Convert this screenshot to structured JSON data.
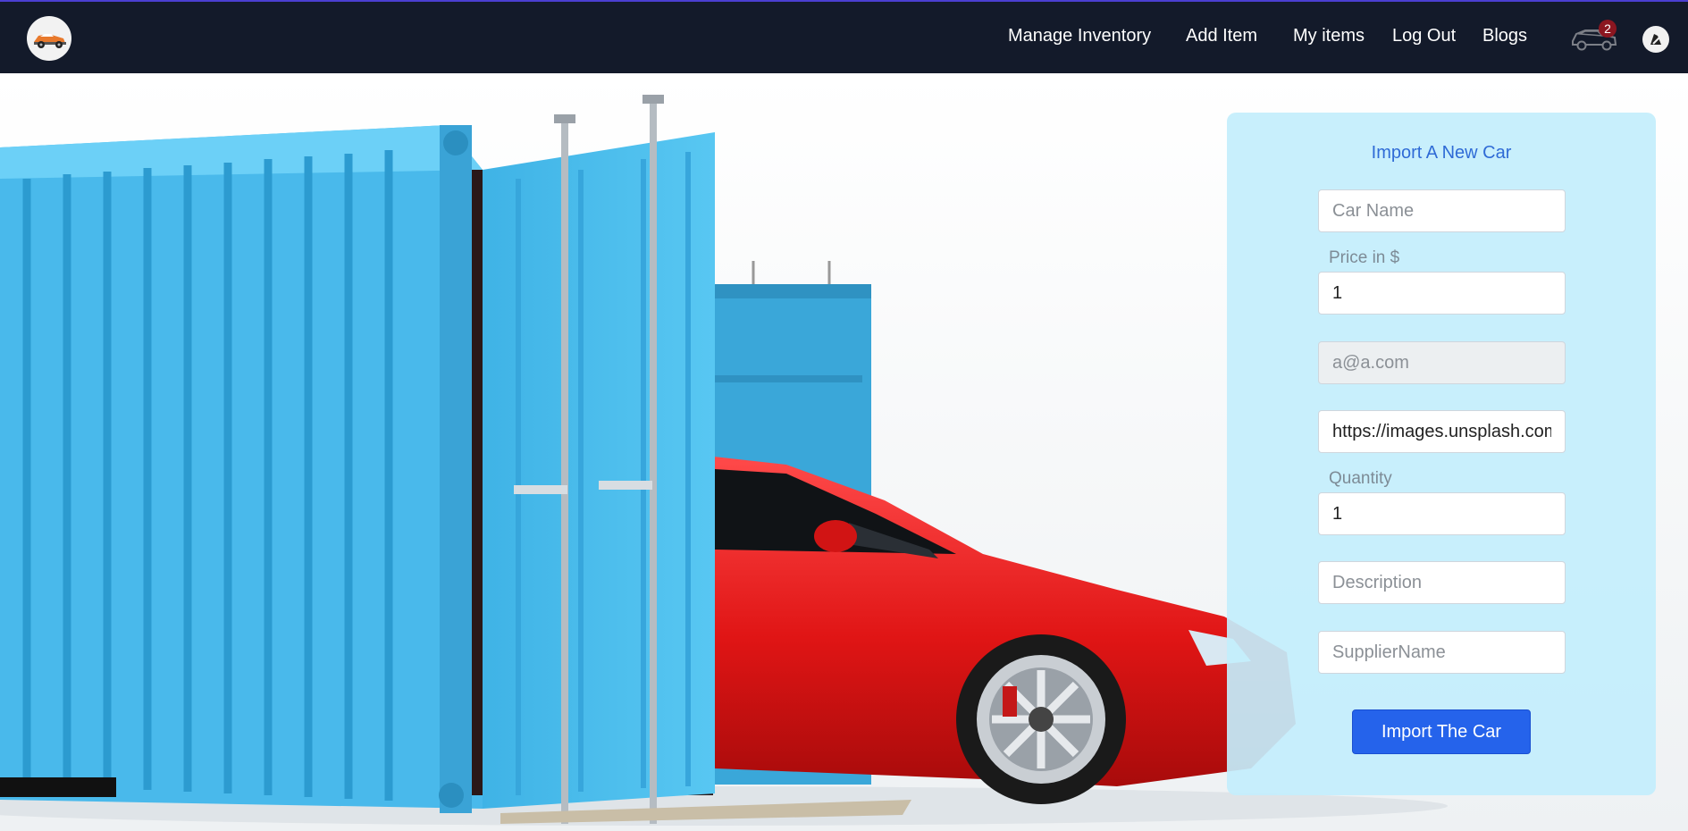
{
  "nav": {
    "links": [
      "Manage Inventory",
      "Add Item",
      "My items",
      "Log Out",
      "Blogs"
    ],
    "cart_count": "2"
  },
  "form": {
    "title": "Import A New Car",
    "car_name_placeholder": "Car Name",
    "price_label": "Price in $",
    "price_value": "1",
    "email_value": "a@a.com",
    "image_url_value": "https://images.unsplash.com",
    "quantity_label": "Quantity",
    "quantity_value": "1",
    "description_placeholder": "Description",
    "supplier_placeholder": "SupplierName",
    "submit_label": "Import The Car"
  },
  "colors": {
    "navbar": "#131a2a",
    "accent_line": "#4b3fd1",
    "form_bg": "#c3eefc",
    "button": "#2563eb",
    "title_text": "#2f6bd6"
  }
}
